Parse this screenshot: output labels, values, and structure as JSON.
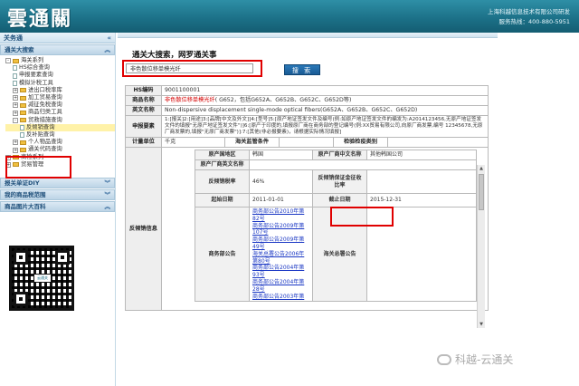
{
  "header": {
    "logo": "雲通關",
    "company": "上海科越信息技术有限公司研发",
    "hotline": "服务热线：400-880-5951"
  },
  "sidebar": {
    "title": "关务通",
    "section_search": "通关大搜索",
    "tree": [
      {
        "label": "海关系列",
        "level": 1,
        "type": "folder",
        "expander": "-"
      },
      {
        "label": "HS综合查询",
        "level": 2,
        "type": "page"
      },
      {
        "label": "申报要素查询",
        "level": 2,
        "type": "page"
      },
      {
        "label": "模拟计税工具",
        "level": 2,
        "type": "page"
      },
      {
        "label": "进出口税率库",
        "level": 2,
        "type": "folder",
        "expander": "+"
      },
      {
        "label": "加工贸易查询",
        "level": 2,
        "type": "folder",
        "expander": "+"
      },
      {
        "label": "减征免税查询",
        "level": 2,
        "type": "folder",
        "expander": "+"
      },
      {
        "label": "商品归类工具",
        "level": 2,
        "type": "folder",
        "expander": "+"
      },
      {
        "label": "贸救措施查询",
        "level": 2,
        "type": "folder",
        "expander": "-"
      },
      {
        "label": "反倾销查询",
        "level": 3,
        "type": "page",
        "selected": true
      },
      {
        "label": "反补贴查询",
        "level": 3,
        "type": "page"
      },
      {
        "label": "个人物品查询",
        "level": 2,
        "type": "folder",
        "expander": "+"
      },
      {
        "label": "通关代码查询",
        "level": 2,
        "type": "folder",
        "expander": "+"
      },
      {
        "label": "商检系列",
        "level": 1,
        "type": "folder",
        "expander": "+"
      },
      {
        "label": "贸易管理",
        "level": 1,
        "type": "folder",
        "expander": "+"
      }
    ],
    "section_diy": "报关单证DIY",
    "section_scope": "我的商品税范围",
    "section_image": "商品图片大百科",
    "qr_label": "云通关"
  },
  "main": {
    "heading": "通关大搜索，网罗通关事",
    "search_value": "非色散位移单模光纤",
    "search_button": "搜 索",
    "rows": {
      "hs_label": "HS编码",
      "hs_value": "9001100001",
      "name_label": "商品名称",
      "name_red": "非色散位移单模光纤",
      "name_rest": "( G652，包括G652A、G652B、G652C、G652D等)",
      "en_label": "英文名称",
      "en_value": "Non-dispersive displacement single-mode optical fibers(G652A、G652B、G652C、G652D)",
      "elements_label": "申报要素",
      "elements_value": "1:[报关]2:[用途]3:[品牌[中文及外文]]4:[型号]5:[原产地证签发文件及编号(例:如原产地证签发文件的编发为:A2014123456,无原产地证签发文件的填报\"无原产地证签发文件\")]6:[原产于印度的,填报原厂商在商务部的登记编号(例:XX贸易有限公司,向原厂商发票,编号 12345678,无原厂商发票的,填报\"无原厂商发票\")]:7:[其他(非必报要素)，请根据实际情况填报]",
      "unit_label": "计量单位",
      "unit_value": "千克",
      "supervision_label": "海关监管条件",
      "supervision_value": "",
      "inspection_label": "检验检疫类别",
      "inspection_value": "",
      "antidumping_label": "反倾销信息",
      "origin_label": "原产国地区",
      "origin_value": "韩国",
      "maker_cn_label": "原产厂商中文名称",
      "maker_cn_value": "其他韩国公司",
      "maker_en_label": "原产厂商英文名称",
      "maker_en_value": "",
      "rate_label": "反倾销税率",
      "rate_value": "46%",
      "guarantee_label": "反倾销保证金征收比率",
      "guarantee_value": "",
      "start_label": "起始日期",
      "start_value": "2011-01-01",
      "end_label": "截止日期",
      "end_value": "2015-12-31",
      "notice_label": "商务部公告",
      "notices": [
        "商务部公告2010年第82号",
        "商务部公告2009年第107号",
        "商务部公告2009年第49号",
        "海关总署公告2006年第80号",
        "商务部公告2004年第93号",
        "商务部公告2004年第28号",
        "商务部公告2003年第"
      ],
      "customs_notice_label": "海关总署公告",
      "customs_notice_value": ""
    }
  },
  "watermark": "科越-云通关"
}
